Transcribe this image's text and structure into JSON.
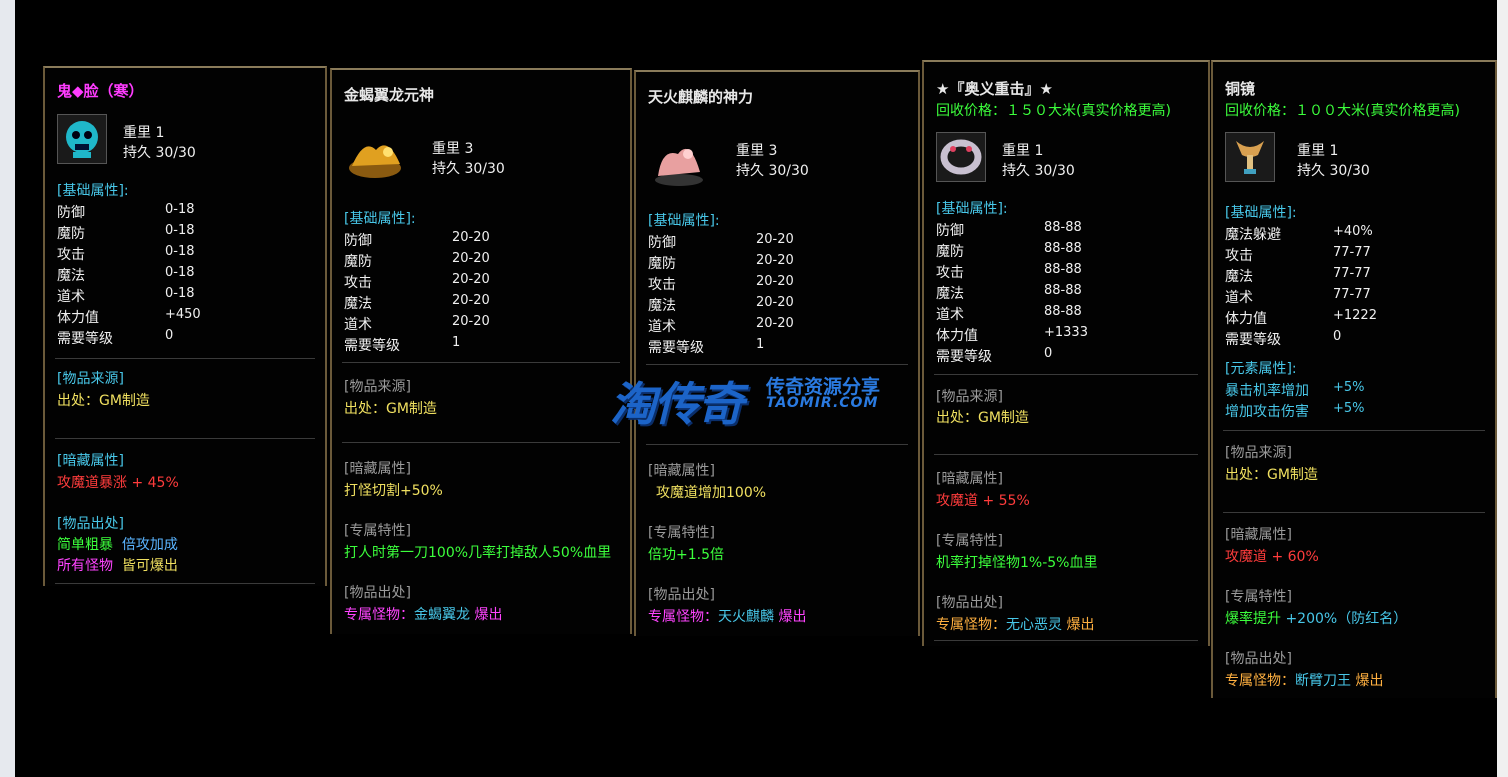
{
  "labels": {
    "weight": "重里",
    "durability": "持久",
    "base_attr": "[基础属性]:",
    "source": "[物品来源]",
    "hidden": "[暗藏属性]",
    "exclusive": "[专属特性]",
    "drop": "[物品出处]",
    "element": "[元素属性]:"
  },
  "cards": [
    {
      "title": "鬼◆脸（寒）",
      "title_color": "#ff3cff",
      "icon": "ghost-mask-icon",
      "weight": "1",
      "durability": "30/30",
      "attrs": [
        {
          "name": "防御",
          "value": "0-18"
        },
        {
          "name": "魔防",
          "value": "0-18"
        },
        {
          "name": "攻击",
          "value": "0-18"
        },
        {
          "name": "魔法",
          "value": "0-18"
        },
        {
          "name": "道术",
          "value": "0-18"
        },
        {
          "name": "体力值",
          "value": "+450"
        },
        {
          "name": "需要等级",
          "value": "0"
        }
      ],
      "source": "出处：GM制造",
      "hidden": "攻魔道暴涨 + 45%",
      "drop_line1_a": "简单粗暴",
      "drop_line1_b": "倍攻加成",
      "drop_line2_a": "所有怪物",
      "drop_line2_b": "皆可爆出"
    },
    {
      "title": "金蝎翼龙元神",
      "title_color": "#ff3c3c",
      "icon": "golden-scorpion-dragon-icon",
      "weight": "3",
      "durability": "30/30",
      "attrs": [
        {
          "name": "防御",
          "value": "20-20"
        },
        {
          "name": "魔防",
          "value": "20-20"
        },
        {
          "name": "攻击",
          "value": "20-20"
        },
        {
          "name": "魔法",
          "value": "20-20"
        },
        {
          "name": "道术",
          "value": "20-20"
        },
        {
          "name": "需要等级",
          "value": "1"
        }
      ],
      "source": "出处：GM制造",
      "hidden": "打怪切割+50%",
      "exclusive": "打人时第一刀100%几率打掉敌人50%血里",
      "drop_prefix": "专属怪物：",
      "drop_monster": "金蝎翼龙",
      "drop_suffix": " 爆出"
    },
    {
      "title": "天火麒麟的神力",
      "title_color": "#ff3c3c",
      "icon": "fire-qilin-icon",
      "weight": "3",
      "durability": "30/30",
      "attrs": [
        {
          "name": "防御",
          "value": "20-20"
        },
        {
          "name": "魔防",
          "value": "20-20"
        },
        {
          "name": "攻击",
          "value": "20-20"
        },
        {
          "name": "魔法",
          "value": "20-20"
        },
        {
          "name": "道术",
          "value": "20-20"
        },
        {
          "name": "需要等级",
          "value": "1"
        }
      ],
      "hidden": "攻魔道增加100%",
      "exclusive": "倍功+1.5倍",
      "drop_prefix": "专属怪物：",
      "drop_monster": "天火麒麟",
      "drop_suffix": " 爆出"
    },
    {
      "title": "★『奥义重击』★",
      "title_color": "#ff3c3c",
      "recycle": "回收价格：１５０大米(真实价格更高)",
      "icon": "bracelet-icon",
      "weight": "1",
      "durability": "30/30",
      "attrs": [
        {
          "name": "防御",
          "value": "88-88"
        },
        {
          "name": "魔防",
          "value": "88-88"
        },
        {
          "name": "攻击",
          "value": "88-88"
        },
        {
          "name": "魔法",
          "value": "88-88"
        },
        {
          "name": "道术",
          "value": "88-88"
        },
        {
          "name": "体力值",
          "value": "+1333"
        },
        {
          "name": "需要等级",
          "value": "0"
        }
      ],
      "source": "出处：GM制造",
      "hidden": "攻魔道 + 55%",
      "exclusive": "机率打掉怪物1%-5%血里",
      "drop_prefix": "专属怪物：",
      "drop_monster": "无心恶灵",
      "drop_suffix": " 爆出"
    },
    {
      "title": "铜镜",
      "title_color": "#ff3c3c",
      "recycle": "回收价格：１００大米(真实价格更高)",
      "icon": "bronze-mirror-icon",
      "weight": "1",
      "durability": "30/30",
      "attrs": [
        {
          "name": "魔法躲避",
          "value": "+40%"
        },
        {
          "name": "攻击",
          "value": "77-77"
        },
        {
          "name": "魔法",
          "value": "77-77"
        },
        {
          "name": "道术",
          "value": "77-77"
        },
        {
          "name": "体力值",
          "value": "+1222"
        },
        {
          "name": "需要等级",
          "value": "0"
        }
      ],
      "elements": [
        {
          "name": "暴击机率增加",
          "value": "+5%"
        },
        {
          "name": "增加攻击伤害",
          "value": "+5%"
        }
      ],
      "source": "出处：GM制造",
      "hidden": "攻魔道 + 60%",
      "exclusive_a": "爆率提升",
      "exclusive_b": " +200%（防红名）",
      "drop_prefix": "专属怪物：",
      "drop_monster": "断臂刀王",
      "drop_suffix": " 爆出"
    }
  ],
  "watermark": {
    "big": "淘传奇",
    "sub": "传奇资源分享",
    "url": "TAOMIR.COM"
  }
}
